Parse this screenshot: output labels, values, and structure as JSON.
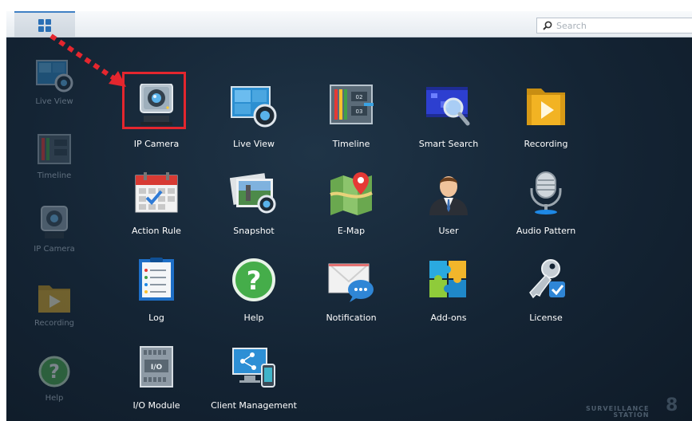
{
  "search": {
    "placeholder": "Search"
  },
  "sidebar": {
    "items": [
      {
        "label": "Live View",
        "icon": "live-view-icon"
      },
      {
        "label": "Timeline",
        "icon": "timeline-icon"
      },
      {
        "label": "IP Camera",
        "icon": "ip-camera-icon"
      },
      {
        "label": "Recording",
        "icon": "recording-icon"
      },
      {
        "label": "Help",
        "icon": "help-icon"
      }
    ]
  },
  "apps": [
    {
      "label": "IP Camera",
      "icon": "ip-camera-icon"
    },
    {
      "label": "Live View",
      "icon": "live-view-icon"
    },
    {
      "label": "Timeline",
      "icon": "timeline-icon"
    },
    {
      "label": "Smart Search",
      "icon": "smart-search-icon"
    },
    {
      "label": "Recording",
      "icon": "recording-icon"
    },
    {
      "label": "Action Rule",
      "icon": "action-rule-icon"
    },
    {
      "label": "Snapshot",
      "icon": "snapshot-icon"
    },
    {
      "label": "E-Map",
      "icon": "emap-icon"
    },
    {
      "label": "User",
      "icon": "user-icon"
    },
    {
      "label": "Audio Pattern",
      "icon": "audio-pattern-icon"
    },
    {
      "label": "Log",
      "icon": "log-icon"
    },
    {
      "label": "Help",
      "icon": "help-icon"
    },
    {
      "label": "Notification",
      "icon": "notification-icon"
    },
    {
      "label": "Add-ons",
      "icon": "addons-icon"
    },
    {
      "label": "License",
      "icon": "license-icon"
    },
    {
      "label": "I/O Module",
      "icon": "io-module-icon"
    },
    {
      "label": "Client Management",
      "icon": "client-management-icon"
    }
  ],
  "timeline_icon_text": {
    "top": "02",
    "bottom": "03"
  },
  "io_icon_text": "I/O",
  "brand": {
    "line1": "SURVEILLANCE",
    "line2": "STATION",
    "version": "8"
  },
  "colors": {
    "accent": "#3f80c4",
    "annotation": "#e4262e",
    "desktop": "#142434"
  }
}
